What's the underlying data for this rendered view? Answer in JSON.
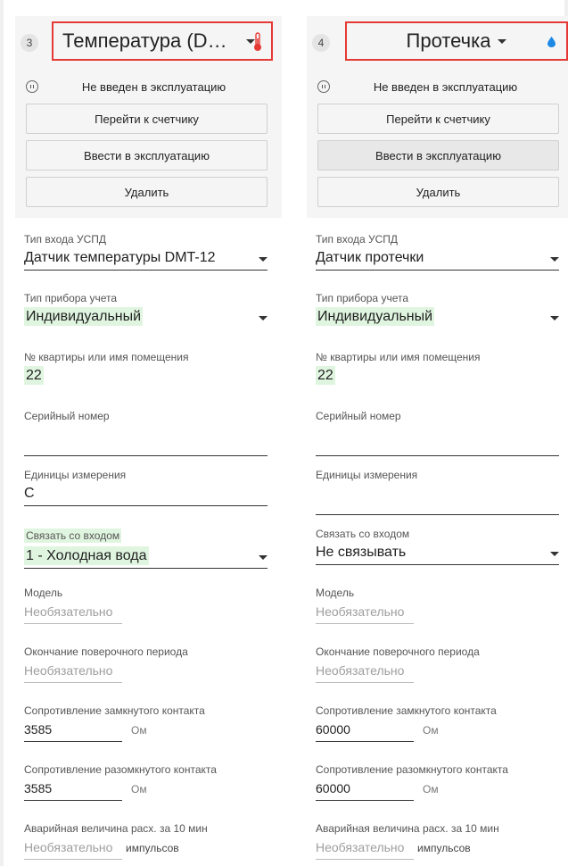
{
  "cards": [
    {
      "number": "3",
      "title": "Температура (DM...",
      "status": "Не введен в эксплуатацию",
      "buttons": {
        "go_to_meter": "Перейти к счетчику",
        "commission": "Ввести в эксплуатацию",
        "delete": "Удалить"
      },
      "fields": {
        "input_type": {
          "label": "Тип входа УСПД",
          "value": "Датчик температуры DMT-12"
        },
        "device_type": {
          "label": "Тип прибора учета",
          "value": "Индивидуальный"
        },
        "apartment": {
          "label": "№ квартиры или имя помещения",
          "value": "22"
        },
        "serial": {
          "label": "Серийный номер",
          "value": ""
        },
        "units": {
          "label": "Единицы измерения",
          "value": "C"
        },
        "link_input": {
          "label": "Связать со входом",
          "value": "1 - Холодная вода"
        },
        "model": {
          "label": "Модель",
          "placeholder": "Необязательно"
        },
        "verification_end": {
          "label": "Окончание поверочного периода",
          "placeholder": "Необязательно"
        },
        "closed_resistance": {
          "label": "Сопротивление замкнутого контакта",
          "value": "3585",
          "unit": "Ом"
        },
        "open_resistance": {
          "label": "Сопротивление разомкнутого контакта",
          "value": "3585",
          "unit": "Ом"
        },
        "alarm_value": {
          "label": "Аварийная величина расх. за 10 мин",
          "placeholder": "Необязательно",
          "unit": "импульсов"
        }
      }
    },
    {
      "number": "4",
      "title": "Протечка",
      "status": "Не введен в эксплуатацию",
      "buttons": {
        "go_to_meter": "Перейти к счетчику",
        "commission": "Ввести в эксплуатацию",
        "delete": "Удалить"
      },
      "fields": {
        "input_type": {
          "label": "Тип входа УСПД",
          "value": "Датчик протечки"
        },
        "device_type": {
          "label": "Тип прибора учета",
          "value": "Индивидуальный"
        },
        "apartment": {
          "label": "№ квартиры или имя помещения",
          "value": "22"
        },
        "serial": {
          "label": "Серийный номер",
          "value": ""
        },
        "units": {
          "label": "Единицы измерения",
          "value": ""
        },
        "link_input": {
          "label": "Связать со входом",
          "value": "Не связывать"
        },
        "model": {
          "label": "Модель",
          "placeholder": "Необязательно"
        },
        "verification_end": {
          "label": "Окончание поверочного периода",
          "placeholder": "Необязательно"
        },
        "closed_resistance": {
          "label": "Сопротивление замкнутого контакта",
          "value": "60000",
          "unit": "Ом"
        },
        "open_resistance": {
          "label": "Сопротивление разомкнутого контакта",
          "value": "60000",
          "unit": "Ом"
        },
        "alarm_value": {
          "label": "Аварийная величина расх. за 10 мин",
          "placeholder": "Необязательно",
          "unit": "импульсов"
        }
      }
    }
  ],
  "colors": {
    "highlight": "#e0f5e0",
    "title_border": "#e53935",
    "thermometer": "#e53935",
    "drop": "#1e88e5",
    "card_header_bg": "#f5f5f5"
  },
  "icons": [
    "pause-circle-icon",
    "thermometer-icon",
    "water-drop-icon",
    "chevron-down-icon"
  ]
}
